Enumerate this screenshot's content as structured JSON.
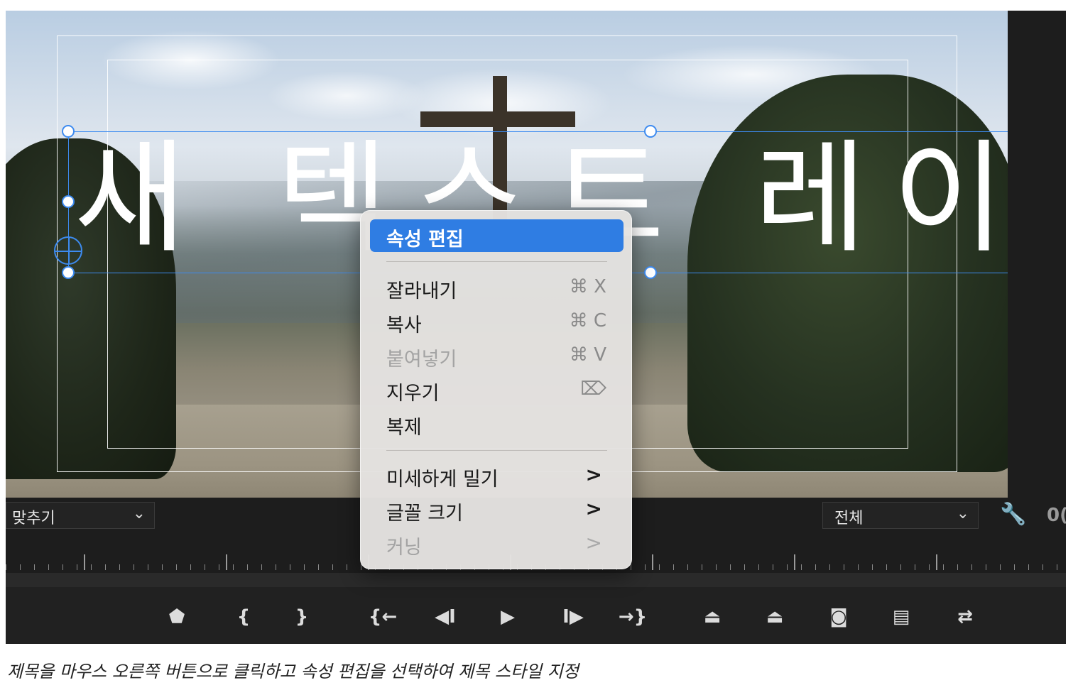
{
  "video": {
    "title_text": "새 텍스트 레이"
  },
  "controls": {
    "fit_dropdown": "맞추기",
    "resolution_dropdown": "전체",
    "timecode": "0("
  },
  "context_menu": {
    "items": [
      {
        "label": "속성 편집",
        "shortcut": "",
        "state": "selected",
        "submenu": false
      },
      {
        "label": "잘라내기",
        "shortcut": "⌘ X",
        "state": "enabled",
        "submenu": false
      },
      {
        "label": "복사",
        "shortcut": "⌘ C",
        "state": "enabled",
        "submenu": false
      },
      {
        "label": "붙여넣기",
        "shortcut": "⌘ V",
        "state": "disabled",
        "submenu": false
      },
      {
        "label": "지우기",
        "shortcut": "⌦",
        "state": "enabled",
        "submenu": false
      },
      {
        "label": "복제",
        "shortcut": "",
        "state": "enabled",
        "submenu": false
      },
      {
        "label": "미세하게 밀기",
        "shortcut": "",
        "state": "enabled",
        "submenu": true
      },
      {
        "label": "글꼴 크기",
        "shortcut": "",
        "state": "enabled",
        "submenu": true
      },
      {
        "label": "커닝",
        "shortcut": "",
        "state": "disabled",
        "submenu": true
      }
    ],
    "submenu_glyph": ">"
  },
  "transport": {
    "buttons": [
      {
        "name": "add-marker",
        "glyph": "⬟"
      },
      {
        "name": "mark-in",
        "glyph": "{"
      },
      {
        "name": "mark-out",
        "glyph": "}"
      },
      {
        "name": "go-to-in",
        "glyph": "{←"
      },
      {
        "name": "step-back",
        "glyph": "◀I"
      },
      {
        "name": "play",
        "glyph": "▶"
      },
      {
        "name": "step-forward",
        "glyph": "I▶"
      },
      {
        "name": "go-to-out",
        "glyph": "→}"
      },
      {
        "name": "lift",
        "glyph": "⏏"
      },
      {
        "name": "extract",
        "glyph": "⏏"
      },
      {
        "name": "export-frame",
        "glyph": "◙"
      },
      {
        "name": "insert",
        "glyph": "▤"
      },
      {
        "name": "overwrite",
        "glyph": "⇄"
      }
    ]
  },
  "caption": "제목을 마우스 오른쪽 버튼으로 클릭하고 속성 편집을 선택하여 제목 스타일 지정",
  "colors": {
    "selection_blue": "#3d8bf0",
    "menu_highlight": "#2f7de3",
    "panel_bg": "#1d1d1d"
  }
}
